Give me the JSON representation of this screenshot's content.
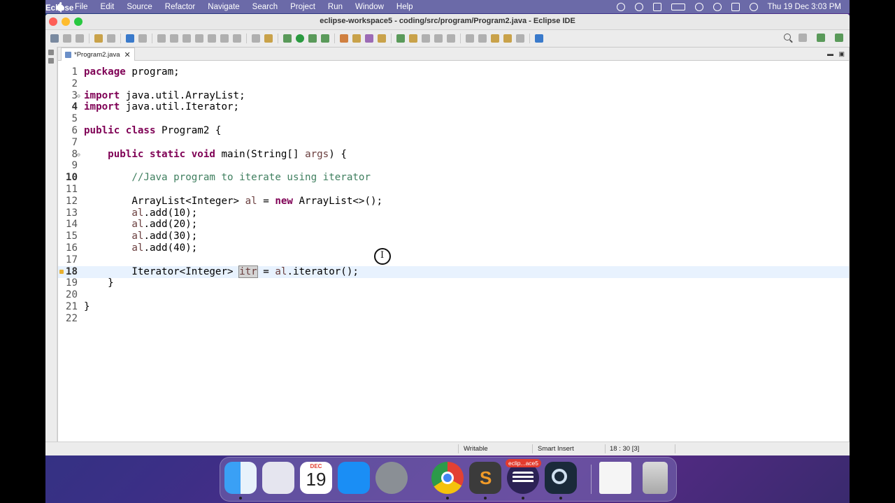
{
  "menubar": {
    "app": "Eclipse",
    "items": [
      "File",
      "Edit",
      "Source",
      "Refactor",
      "Navigate",
      "Search",
      "Project",
      "Run",
      "Window",
      "Help"
    ],
    "clock": "Thu 19 Dec  3:03 PM"
  },
  "window": {
    "title": "eclipse-workspace5 - coding/src/program/Program2.java - Eclipse IDE"
  },
  "editor": {
    "tab_label": "*Program2.java",
    "tab_close": "✕",
    "current_line": 18,
    "lines": [
      {
        "n": "1",
        "code": "package program;"
      },
      {
        "n": "2",
        "code": ""
      },
      {
        "n": "3",
        "code": "import java.util.ArrayList;"
      },
      {
        "n": "4",
        "code": "import java.util.Iterator;"
      },
      {
        "n": "5",
        "code": ""
      },
      {
        "n": "6",
        "code": "public class Program2 {"
      },
      {
        "n": "7",
        "code": ""
      },
      {
        "n": "8",
        "code": "    public static void main(String[] args) {"
      },
      {
        "n": "9",
        "code": ""
      },
      {
        "n": "10",
        "code": "        //Java program to iterate using iterator"
      },
      {
        "n": "11",
        "code": ""
      },
      {
        "n": "12",
        "code": "        ArrayList<Integer> al = new ArrayList<>();"
      },
      {
        "n": "13",
        "code": "        al.add(10);"
      },
      {
        "n": "14",
        "code": "        al.add(20);"
      },
      {
        "n": "15",
        "code": "        al.add(30);"
      },
      {
        "n": "16",
        "code": "        al.add(40);"
      },
      {
        "n": "17",
        "code": ""
      },
      {
        "n": "18",
        "code": "        Iterator<Integer> itr = al.iterator();"
      },
      {
        "n": "19",
        "code": "    }"
      },
      {
        "n": "20",
        "code": ""
      },
      {
        "n": "21",
        "code": "}"
      },
      {
        "n": "22",
        "code": ""
      }
    ]
  },
  "statusbar": {
    "mode": "Writable",
    "insert": "Smart Insert",
    "position": "18 : 30 [3]"
  },
  "dock": {
    "calendar_month": "DEC",
    "calendar_day": "19",
    "eclipse_badge": "eclip...ace5"
  },
  "colors": {
    "keyword": "#7f0055",
    "comment": "#3f7f5f",
    "variable": "#6a3e3e",
    "current_line": "#e8f2fe"
  }
}
